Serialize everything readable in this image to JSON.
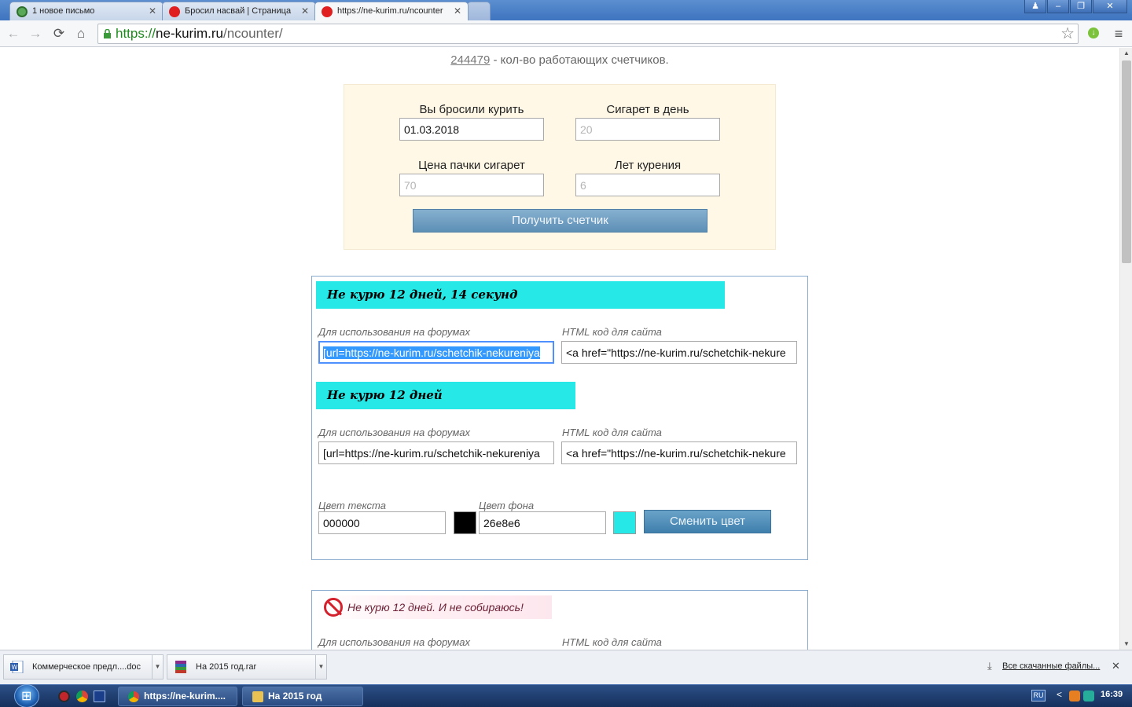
{
  "browser": {
    "tabs": [
      {
        "title": "1 новое письмо",
        "active": false
      },
      {
        "title": "Бросил насвай | Страница",
        "active": false
      },
      {
        "title": "https://ne-kurim.ru/ncounter",
        "active": true
      }
    ],
    "url": {
      "scheme": "https://",
      "host": "ne-kurim.ru",
      "path": "/ncounter/"
    }
  },
  "page": {
    "stat": {
      "count": "244479",
      "text": " - кол-во работающих счетчиков."
    },
    "form": {
      "quit_date_label": "Вы бросили курить",
      "quit_date_value": "01.03.2018",
      "cigs_per_day_label": "Сигарет в день",
      "cigs_per_day_placeholder": "20",
      "pack_price_label": "Цена пачки сигарет",
      "pack_price_placeholder": "70",
      "years_label": "Лет курения",
      "years_placeholder": "6",
      "submit_label": "Получить счетчик"
    },
    "counter1": {
      "banner_full": "Не курю 12 дней, 14 секунд",
      "banner_short": "Не курю 12 дней",
      "forum_label": "Для использования на форумах",
      "html_label": "HTML код для сайта",
      "forum_code_1": "[url=https://ne-kurim.ru/schetchik-nekureniya",
      "html_code_1": "<a href=\"https://ne-kurim.ru/schetchik-nekure",
      "forum_code_2": "[url=https://ne-kurim.ru/schetchik-nekureniya",
      "html_code_2": "<a href=\"https://ne-kurim.ru/schetchik-nekure",
      "text_color_label": "Цвет текста",
      "text_color_value": "000000",
      "bg_color_label": "Цвет фона",
      "bg_color_value": "26e8e6",
      "change_color_label": "Сменить цвет",
      "text_color_hex": "#000000",
      "bg_color_hex": "#26e8e6"
    },
    "counter2": {
      "banner": "Не курю 12 дней. И не собираюсь!",
      "forum_label": "Для использования на форумах",
      "html_label": "HTML код для сайта"
    }
  },
  "downloads": {
    "items": [
      {
        "name": "Коммерческое предл....doc",
        "icon": "word-doc-icon"
      },
      {
        "name": "На 2015 год.rar",
        "icon": "rar-archive-icon"
      }
    ],
    "show_all": "Все скачанные файлы..."
  },
  "taskbar": {
    "buttons": [
      {
        "label": "https://ne-kurim....",
        "icon": "chrome-icon"
      },
      {
        "label": "На 2015 год",
        "icon": "folder-icon"
      }
    ],
    "lang": "RU",
    "time": "16:39"
  }
}
